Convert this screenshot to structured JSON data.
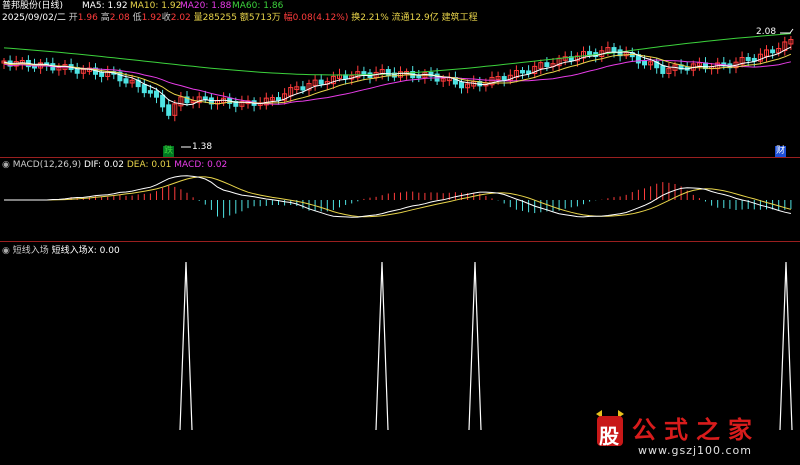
{
  "header": {
    "title": "普邦股份(日线)",
    "ma5": "MA5: 1.92",
    "ma10": "MA10: 1.92",
    "ma20": "MA20: 1.88",
    "ma60": "MA60: 1.86"
  },
  "quote": {
    "date": "2025/09/02/二",
    "open_label": "开",
    "open": "1.96",
    "high_label": "高",
    "high": "2.08",
    "low_label": "低",
    "low": "1.92",
    "close_label": "收",
    "close": "2.02",
    "volume": "量285255",
    "amount": "额5713万",
    "change": "幅0.08(4.12%)",
    "turnover": "换2.21%",
    "float_cap": "流通12.9亿",
    "sector": "建筑工程"
  },
  "markers": {
    "high_price": "2.08",
    "low_price": "1.38",
    "buy_tag": "跌",
    "cai_tag": "财"
  },
  "macd_panel": {
    "name": "MACD(12,26,9)",
    "dif": "DIF: 0.02",
    "dea": "DEA: 0.01",
    "macd": "MACD: 0.02"
  },
  "signal_panel": {
    "name": "短线入场",
    "value": "短线入场X: 0.00"
  },
  "watermark": {
    "logo_char": "股",
    "chars": "公式之家",
    "url": "www.gszj100.com"
  },
  "colors": {
    "up": "#ff3c3c",
    "down": "#4fe3e3",
    "ma5": "#ffffff",
    "ma10": "#e8d44a",
    "ma20": "#e83ce8",
    "ma60": "#3cd23c",
    "divider": "#9a1f1f"
  }
}
